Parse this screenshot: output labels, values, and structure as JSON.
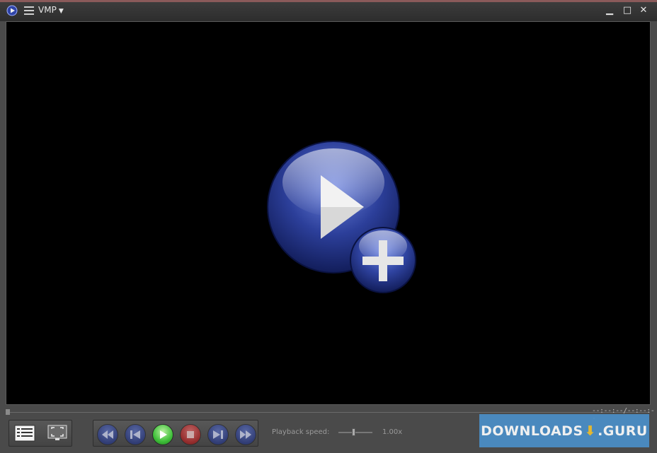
{
  "window": {
    "title": "VMP",
    "minimize_glyph": "▁",
    "maximize_glyph": "□",
    "close_glyph": "✕"
  },
  "player": {
    "time_display": "--:--:--/--:--:--",
    "speed_label": "Playback speed:",
    "speed_value": "1.00x",
    "speed_level_fraction": 0.45,
    "seek_position_fraction": 0
  },
  "controls": {
    "left_panel": [
      "playlist-icon",
      "fullscreen-icon"
    ],
    "transport": [
      "rewind-icon",
      "previous-icon",
      "play-icon",
      "stop-icon",
      "next-icon",
      "fast-forward-icon"
    ]
  },
  "watermark": {
    "text_left": "DOWNLOADS",
    "text_right": ".GURU"
  },
  "colors": {
    "accent_blue": "#2a3a85",
    "play_green": "#3fbf3a",
    "stop_red": "#b02525",
    "watermark_bg": "#4a8fc8"
  }
}
